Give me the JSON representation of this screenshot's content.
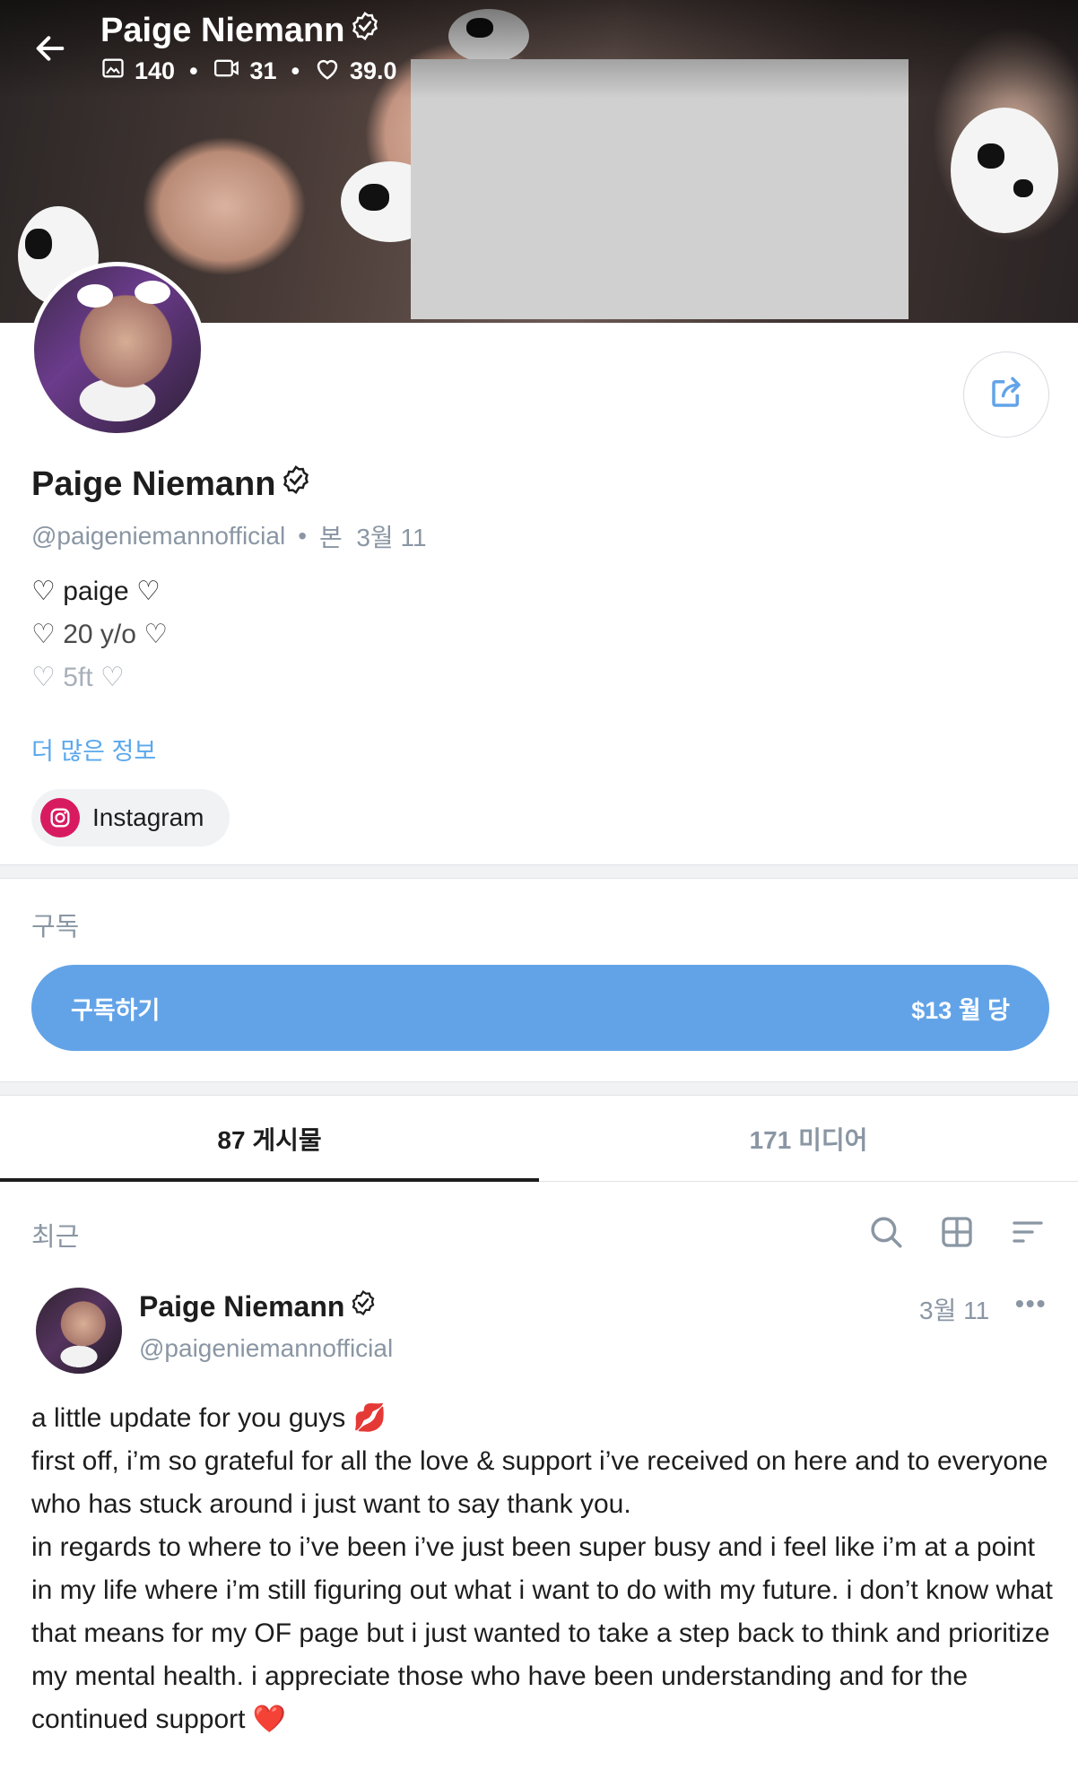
{
  "header": {
    "name": "Paige Niemann",
    "stats": {
      "photos": "140",
      "videos": "31",
      "likes": "39.0"
    }
  },
  "profile": {
    "name": "Paige Niemann",
    "handle": "@paigeniemannofficial",
    "seen_label": "본",
    "seen_date": "3월 11",
    "bio": [
      "♡ paige ♡",
      "♡ 20 y/o ♡",
      "♡ 5ft ♡"
    ],
    "more_info": "더 많은 정보",
    "instagram_label": "Instagram"
  },
  "subscription": {
    "section_label": "구독",
    "button_label": "구독하기",
    "price_label": "$13 월 당"
  },
  "tabs": {
    "posts": "87 게시물",
    "media": "171 미디어"
  },
  "feed": {
    "filter_label": "최근"
  },
  "post": {
    "name": "Paige Niemann",
    "handle": "@paigeniemannofficial",
    "date": "3월 11",
    "more": "•••",
    "lines": [
      "a little update for you guys 💋",
      "first off, i’m so grateful for all the love & support i’ve received on here and to everyone who has stuck around i just want to say thank you.",
      "in regards to where to i’ve been i’ve just been super busy and i feel like i’m at a point in my life where i’m still figuring out what i want to do with my future. i don’t know what that means for my OF page but i just wanted to take a step back to think and prioritize my mental health. i appreciate those who have been understanding and for the continued support ❤️"
    ]
  },
  "colors": {
    "accent": "#62a3e8",
    "link": "#5aa8ec",
    "muted": "#8a96a3",
    "instagram": "#d81b60"
  }
}
